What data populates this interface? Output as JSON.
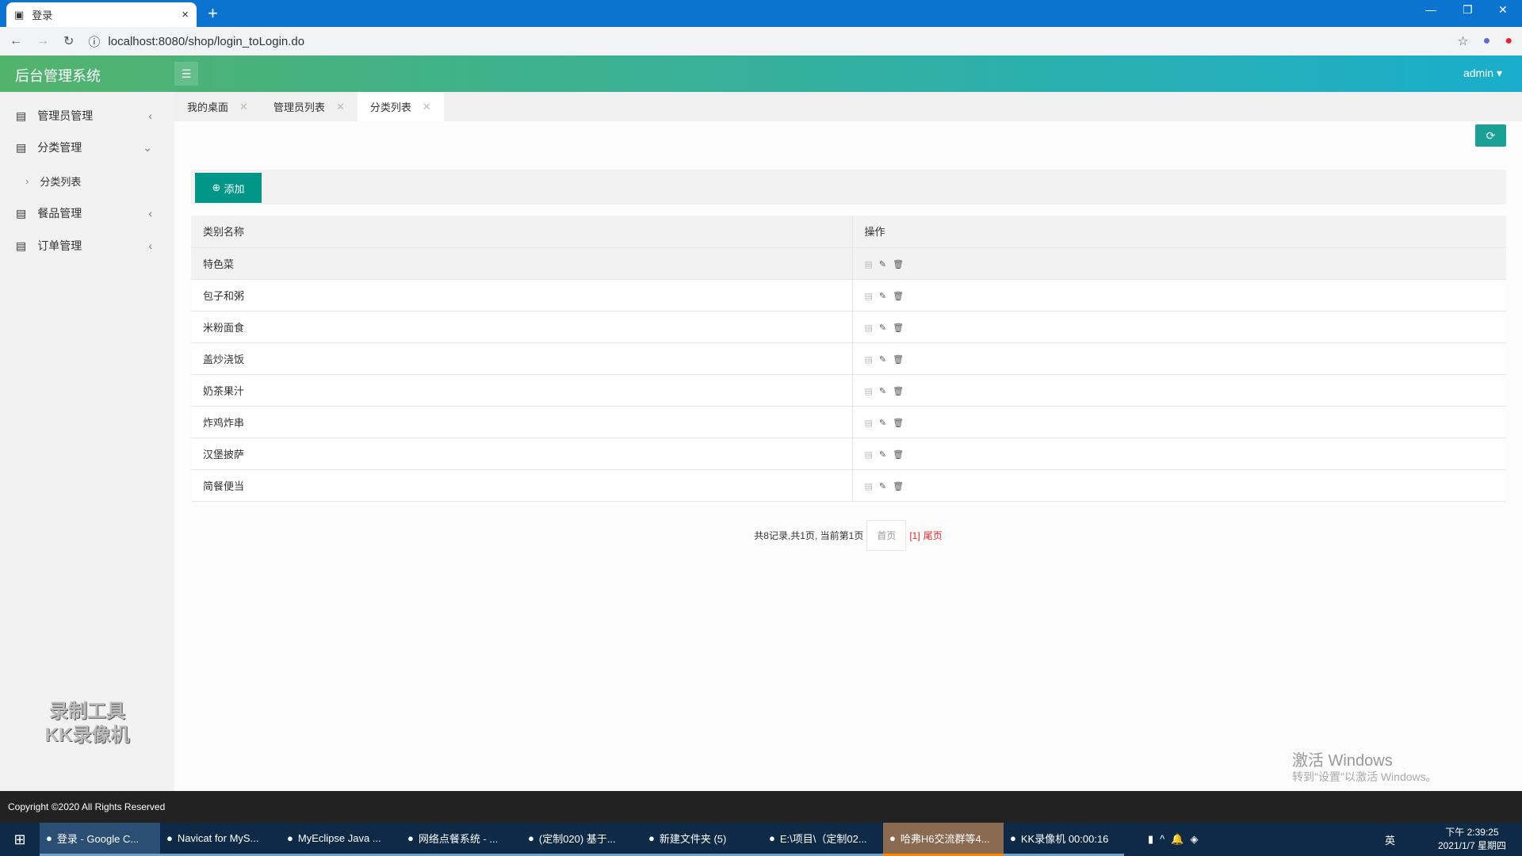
{
  "browser": {
    "tab_title": "登录",
    "url": "localhost:8080/shop/login_toLogin.do"
  },
  "header": {
    "title": "后台管理系统",
    "user": "admin"
  },
  "sidebar": {
    "items": [
      {
        "label": "管理员管理"
      },
      {
        "label": "分类管理"
      },
      {
        "label": "分类列表"
      },
      {
        "label": "餐品管理"
      },
      {
        "label": "订单管理"
      }
    ]
  },
  "tabs": [
    {
      "label": "我的桌面"
    },
    {
      "label": "管理员列表"
    },
    {
      "label": "分类列表"
    }
  ],
  "toolbar": {
    "add_label": "添加"
  },
  "table": {
    "headers": [
      "类别名称",
      "操作"
    ],
    "rows": [
      "特色菜",
      "包子和粥",
      "米粉面食",
      "盖炒浇饭",
      "奶茶果汁",
      "炸鸡炸串",
      "汉堡披萨",
      "简餐便当"
    ]
  },
  "pager": {
    "summary": "共8记录,共1页, 当前第1页",
    "first": "首页",
    "current": "[1]",
    "last": "尾页"
  },
  "footer": {
    "copyright": "Copyright ©2020 All Rights Reserved"
  },
  "watermark": {
    "line1": "激活 Windows",
    "line2": "转到\"设置\"以激活 Windows。",
    "kk1": "录制工具",
    "kk2": "KK录像机"
  },
  "taskbar": {
    "items": [
      "登录 - Google C...",
      "Navicat for MyS...",
      "MyEclipse Java ...",
      "网络点餐系统 - ...",
      "(定制020) 基于...",
      "新建文件夹 (5)",
      "E:\\项目\\（定制02...",
      "哈弗H6交流群等4...",
      "KK录像机 00:00:16"
    ],
    "time": "下午 2:39:25",
    "date": "2021/1/7 星期四",
    "ime": "英"
  }
}
